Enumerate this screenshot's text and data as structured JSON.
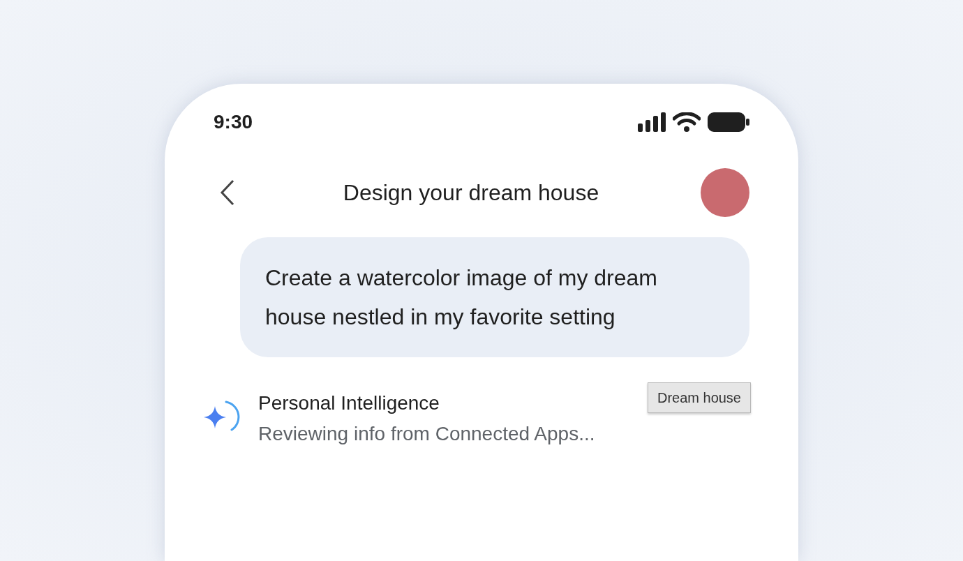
{
  "status_bar": {
    "time": "9:30"
  },
  "header": {
    "title": "Design your dream house"
  },
  "user_message": {
    "text": "Create a watercolor image of my dream house nestled in my favorite setting"
  },
  "response": {
    "title": "Personal Intelligence",
    "status": "Reviewing info from Connected Apps..."
  },
  "tooltip": {
    "text": "Dream house"
  }
}
